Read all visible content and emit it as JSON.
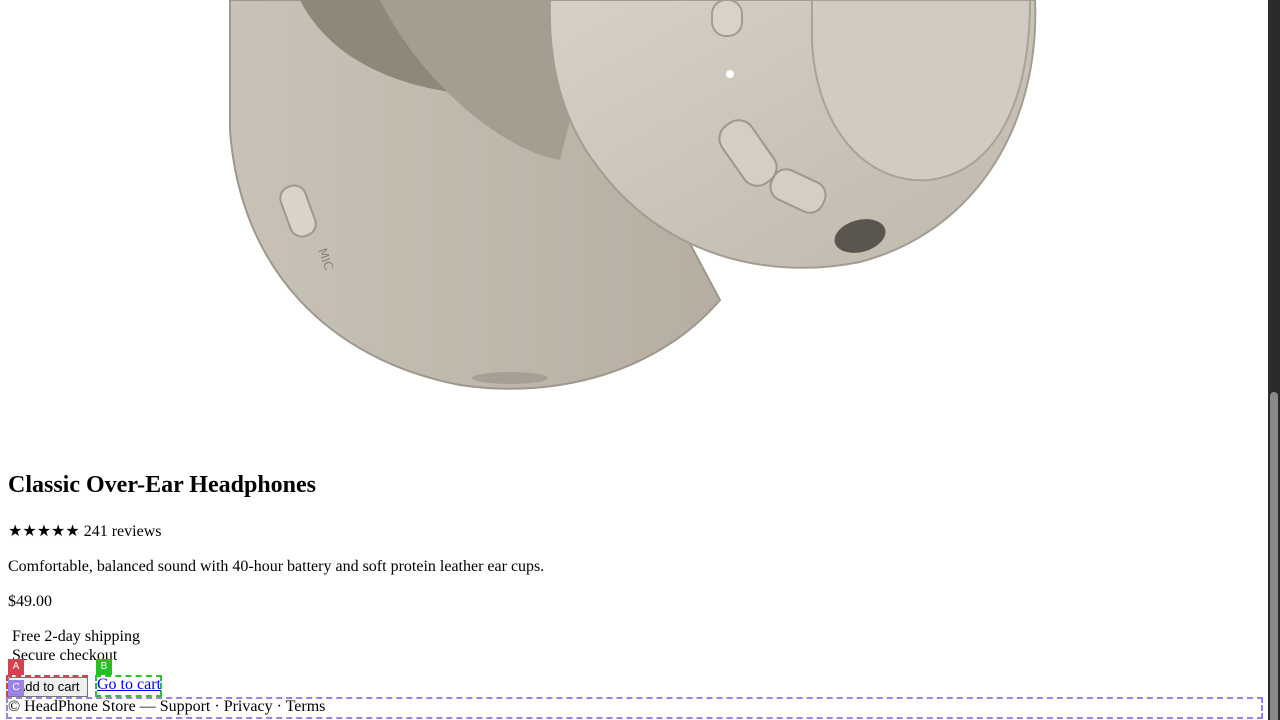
{
  "product": {
    "image_name": "headphones-product-image",
    "title": "Classic Over-Ear Headphones",
    "stars": "★★★★★",
    "reviews": "241 reviews",
    "rating_value": 5,
    "rating_max": 5,
    "description": "Comfortable, balanced sound with 40-hour battery and soft protein leather ear cups.",
    "price": "$49.00",
    "perks": [
      "Free 2-day shipping",
      "Secure checkout"
    ]
  },
  "actions": {
    "add_to_cart": "Add to cart",
    "go_to_cart": "Go to cart"
  },
  "footer": {
    "text": "© HeadPhone Store — Support · Privacy · Terms"
  },
  "markers": {
    "a": "A",
    "b": "B",
    "c": "C"
  },
  "colors": {
    "marker_a": "#d4424e",
    "marker_b": "#22c022",
    "marker_c": "#9b82e6",
    "link": "#0000ee",
    "headphone_shell": "#cdc6ba"
  }
}
